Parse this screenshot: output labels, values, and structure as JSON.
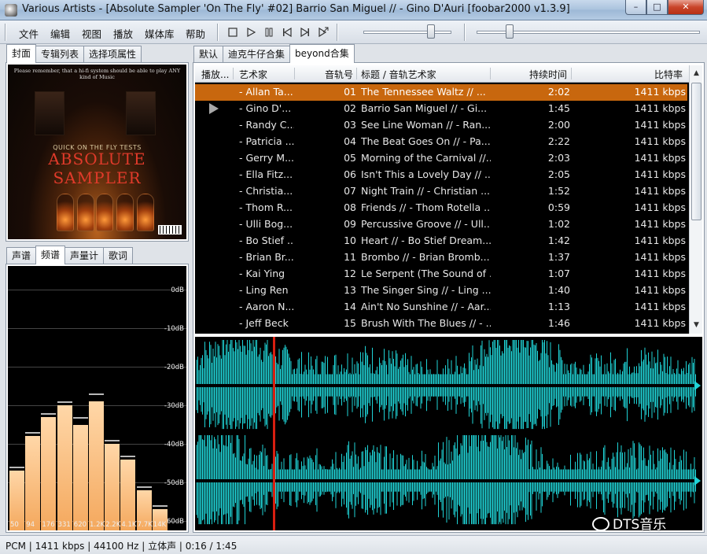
{
  "window": {
    "title": "Various Artists - [Absolute Sampler 'On The Fly' #02] Barrio San Miguel //  - Gino D'Auri   [foobar2000 v1.3.9]",
    "min": "–",
    "max": "□",
    "close": "✕"
  },
  "menu": {
    "items": [
      "文件",
      "编辑",
      "视图",
      "播放",
      "媒体库",
      "帮助"
    ]
  },
  "toolbar": {
    "stop_icon": "stop-icon",
    "play_icon": "play-icon",
    "pause_icon": "pause-icon",
    "prev_icon": "previous-icon",
    "next_icon": "next-icon",
    "random_icon": "random-icon"
  },
  "left_top_tabs": [
    "封面",
    "专辑列表",
    "选择项属性"
  ],
  "left_bottom_tabs": [
    "声谱",
    "频谱",
    "声量计",
    "歌词"
  ],
  "playlist_tabs": [
    "默认",
    "迪克牛仔合集",
    "beyond合集"
  ],
  "cover": {
    "top_text": "Please remember, that a hi-fi system should be able to play ANY kind of Music",
    "subtitle": "QUICK ON THE FLY TESTS",
    "title": "ABSOLUTE SAMPLER"
  },
  "spectrum": {
    "db_labels": [
      "0dB",
      "-10dB",
      "-20dB",
      "-30dB",
      "-40dB",
      "-50dB",
      "-60dB"
    ],
    "freq_labels": [
      "50",
      "94",
      "176",
      "331",
      "620",
      "1.2K",
      "2.2K",
      "4.1K",
      "7.7K",
      "14K"
    ],
    "levels_db": [
      -47,
      -38,
      -33,
      -30,
      -35,
      -29,
      -40,
      -44,
      -52,
      -57
    ],
    "peaks_db": [
      -47,
      -38,
      -33,
      -30,
      -34,
      -28,
      -40,
      -44,
      -52,
      -57
    ]
  },
  "playlist": {
    "columns": [
      "播放...",
      "艺术家",
      "音轨号",
      "标题 / 音轨艺术家",
      "持续时间",
      "比特率"
    ],
    "rows": [
      {
        "artist": "- Allan Ta...",
        "track": "01",
        "title": "The Tennessee Waltz //  ...",
        "duration": "2:02",
        "bitrate": "1411 kbps",
        "selected": true,
        "playing": false
      },
      {
        "artist": "- Gino D'...",
        "track": "02",
        "title": "Barrio San Miguel //  - Gi...",
        "duration": "1:45",
        "bitrate": "1411 kbps",
        "selected": false,
        "playing": true
      },
      {
        "artist": "- Randy C...",
        "track": "03",
        "title": "See Line Woman //  - Ran...",
        "duration": "2:00",
        "bitrate": "1411 kbps",
        "selected": false,
        "playing": false
      },
      {
        "artist": "- Patricia ...",
        "track": "04",
        "title": "The Beat Goes On //  - Pa...",
        "duration": "2:22",
        "bitrate": "1411 kbps",
        "selected": false,
        "playing": false
      },
      {
        "artist": "- Gerry M...",
        "track": "05",
        "title": "Morning of the Carnival //...",
        "duration": "2:03",
        "bitrate": "1411 kbps",
        "selected": false,
        "playing": false
      },
      {
        "artist": "- Ella Fitz...",
        "track": "06",
        "title": "Isn't This a Lovely Day //  ...",
        "duration": "2:05",
        "bitrate": "1411 kbps",
        "selected": false,
        "playing": false
      },
      {
        "artist": "- Christia...",
        "track": "07",
        "title": "Night Train //  - Christian ...",
        "duration": "1:52",
        "bitrate": "1411 kbps",
        "selected": false,
        "playing": false
      },
      {
        "artist": "- Thom R...",
        "track": "08",
        "title": "Friends //  - Thom Rotella ...",
        "duration": "0:59",
        "bitrate": "1411 kbps",
        "selected": false,
        "playing": false
      },
      {
        "artist": "- Ulli Bog...",
        "track": "09",
        "title": "Percussive Groove //  - Ull...",
        "duration": "1:02",
        "bitrate": "1411 kbps",
        "selected": false,
        "playing": false
      },
      {
        "artist": "- Bo Stief ...",
        "track": "10",
        "title": "Heart //  - Bo Stief Dream...",
        "duration": "1:42",
        "bitrate": "1411 kbps",
        "selected": false,
        "playing": false
      },
      {
        "artist": "- Brian Br...",
        "track": "11",
        "title": "Brombo //  - Brian Bromb...",
        "duration": "1:37",
        "bitrate": "1411 kbps",
        "selected": false,
        "playing": false
      },
      {
        "artist": "- Kai Ying",
        "track": "12",
        "title": "Le Serpent (The Sound of ...",
        "duration": "1:07",
        "bitrate": "1411 kbps",
        "selected": false,
        "playing": false
      },
      {
        "artist": "- Ling Ren",
        "track": "13",
        "title": "The Singer Sing //  - Ling ...",
        "duration": "1:40",
        "bitrate": "1411 kbps",
        "selected": false,
        "playing": false
      },
      {
        "artist": "- Aaron N...",
        "track": "14",
        "title": "Ain't No Sunshine //  - Aar...",
        "duration": "1:13",
        "bitrate": "1411 kbps",
        "selected": false,
        "playing": false
      },
      {
        "artist": "- Jeff Beck",
        "track": "15",
        "title": "Brush With The Blues //  - ...",
        "duration": "1:46",
        "bitrate": "1411 kbps",
        "selected": false,
        "playing": false
      }
    ]
  },
  "seekbar": {
    "position_fraction": 0.15
  },
  "volume": {
    "level_fraction": 0.9
  },
  "waveform": {
    "playback_fraction": 0.15,
    "color": "#1fd3d6",
    "cursor_color": "#d81f10"
  },
  "status": {
    "text": "PCM | 1411 kbps | 44100 Hz | 立体声 | 0:16 / 1:45"
  },
  "watermark": {
    "text": "DTS音乐"
  }
}
